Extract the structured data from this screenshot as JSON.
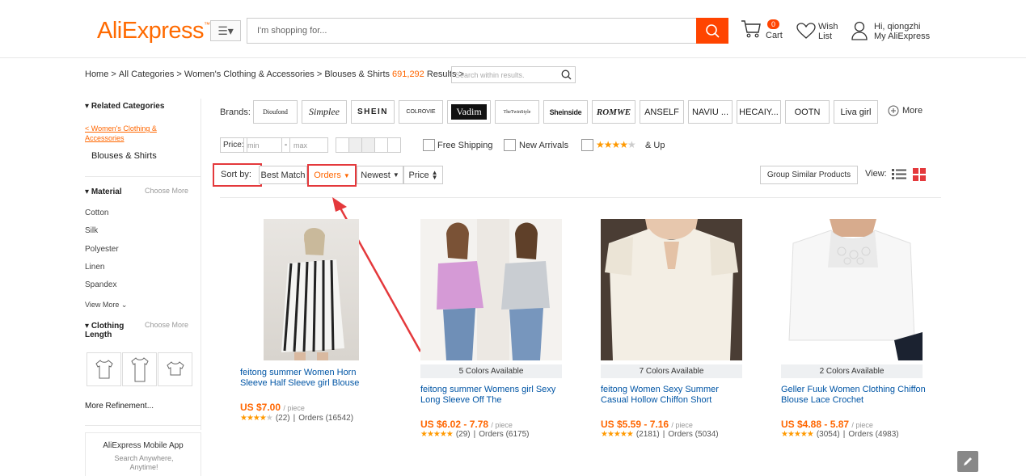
{
  "header": {
    "logo": "AliExpress",
    "search_placeholder": "I'm shopping for...",
    "cart_count": "0",
    "cart_label": "Cart",
    "wish_line1": "Wish",
    "wish_line2": "List",
    "user_line1": "Hi, qiongzhi",
    "user_line2": "My AliExpress"
  },
  "breadcrumb": {
    "home": "Home",
    "all": "All Categories",
    "women": "Women's Clothing & Accessories",
    "current": "Blouses & Shirts",
    "count": "691,292",
    "results": "Results",
    "search_placeholder": "Search within results."
  },
  "sidebar": {
    "related_heading": "Related Categories",
    "back_link": "< Women's Clothing & Accessories",
    "current_cat": "Blouses & Shirts",
    "material_heading": "Material",
    "choose_more": "Choose More",
    "materials": [
      "Cotton",
      "Silk",
      "Polyester",
      "Linen",
      "Spandex"
    ],
    "view_more": "View More",
    "length_heading": "Clothing Length",
    "choose_more2": "Choose More",
    "more_refinement": "More Refinement...",
    "app_title": "AliExpress Mobile App",
    "app_sub": "Search Anywhere, Anytime!"
  },
  "filters": {
    "brands_label": "Brands:",
    "brands": [
      "Dioufond",
      "Simplee",
      "SHEIN",
      "COLROVIE",
      "Vadim",
      "TheTwinStyle",
      "Sheinside",
      "ROMWE",
      "ANSELF",
      "NAVIU ...",
      "HECAIY...",
      "OOTN",
      "Liva girl"
    ],
    "more_label": "More",
    "price_label": "Price:",
    "min_placeholder": "min",
    "max_placeholder": "max",
    "dash": "-",
    "free_shipping": "Free Shipping",
    "new_arrivals": "New Arrivals",
    "stars_up": "& Up"
  },
  "sort": {
    "label": "Sort by:",
    "best_match": "Best Match",
    "orders": "Orders",
    "newest": "Newest",
    "price": "Price",
    "group_similar": "Group Similar Products",
    "view_label": "View:"
  },
  "products": [
    {
      "colors": "",
      "title": "feitong summer Women Horn Sleeve Half Sleeve girl Blouse",
      "price": "US $7.00",
      "unit": "/ piece",
      "rating_count": "(22)",
      "orders": "Orders (16542)",
      "stars": 4
    },
    {
      "colors": "5 Colors Available",
      "title": "feitong summer Womens girl Sexy Long Sleeve Off The",
      "price": "US $6.02 - 7.78",
      "unit": "/ piece",
      "rating_count": "(29)",
      "orders": "Orders (6175)",
      "stars": 5
    },
    {
      "colors": "7 Colors Available",
      "title": "feitong Women Sexy Summer Casual Hollow Chiffon Short",
      "price": "US $5.59 - 7.16",
      "unit": "/ piece",
      "rating_count": "(2181)",
      "orders": "Orders (5034)",
      "stars": 5
    },
    {
      "colors": "2 Colors Available",
      "title": "Geller Fuuk Women Clothing Chiffon Blouse Lace Crochet",
      "price": "US $4.88 - 5.87",
      "unit": "/ piece",
      "rating_count": "(3054)",
      "orders": "Orders (4983)",
      "stars": 5
    }
  ],
  "colors": {
    "accent": "#ff6a00",
    "search_btn": "#ff4400",
    "highlight_box": "#e4393c",
    "link": "#0055a5"
  }
}
